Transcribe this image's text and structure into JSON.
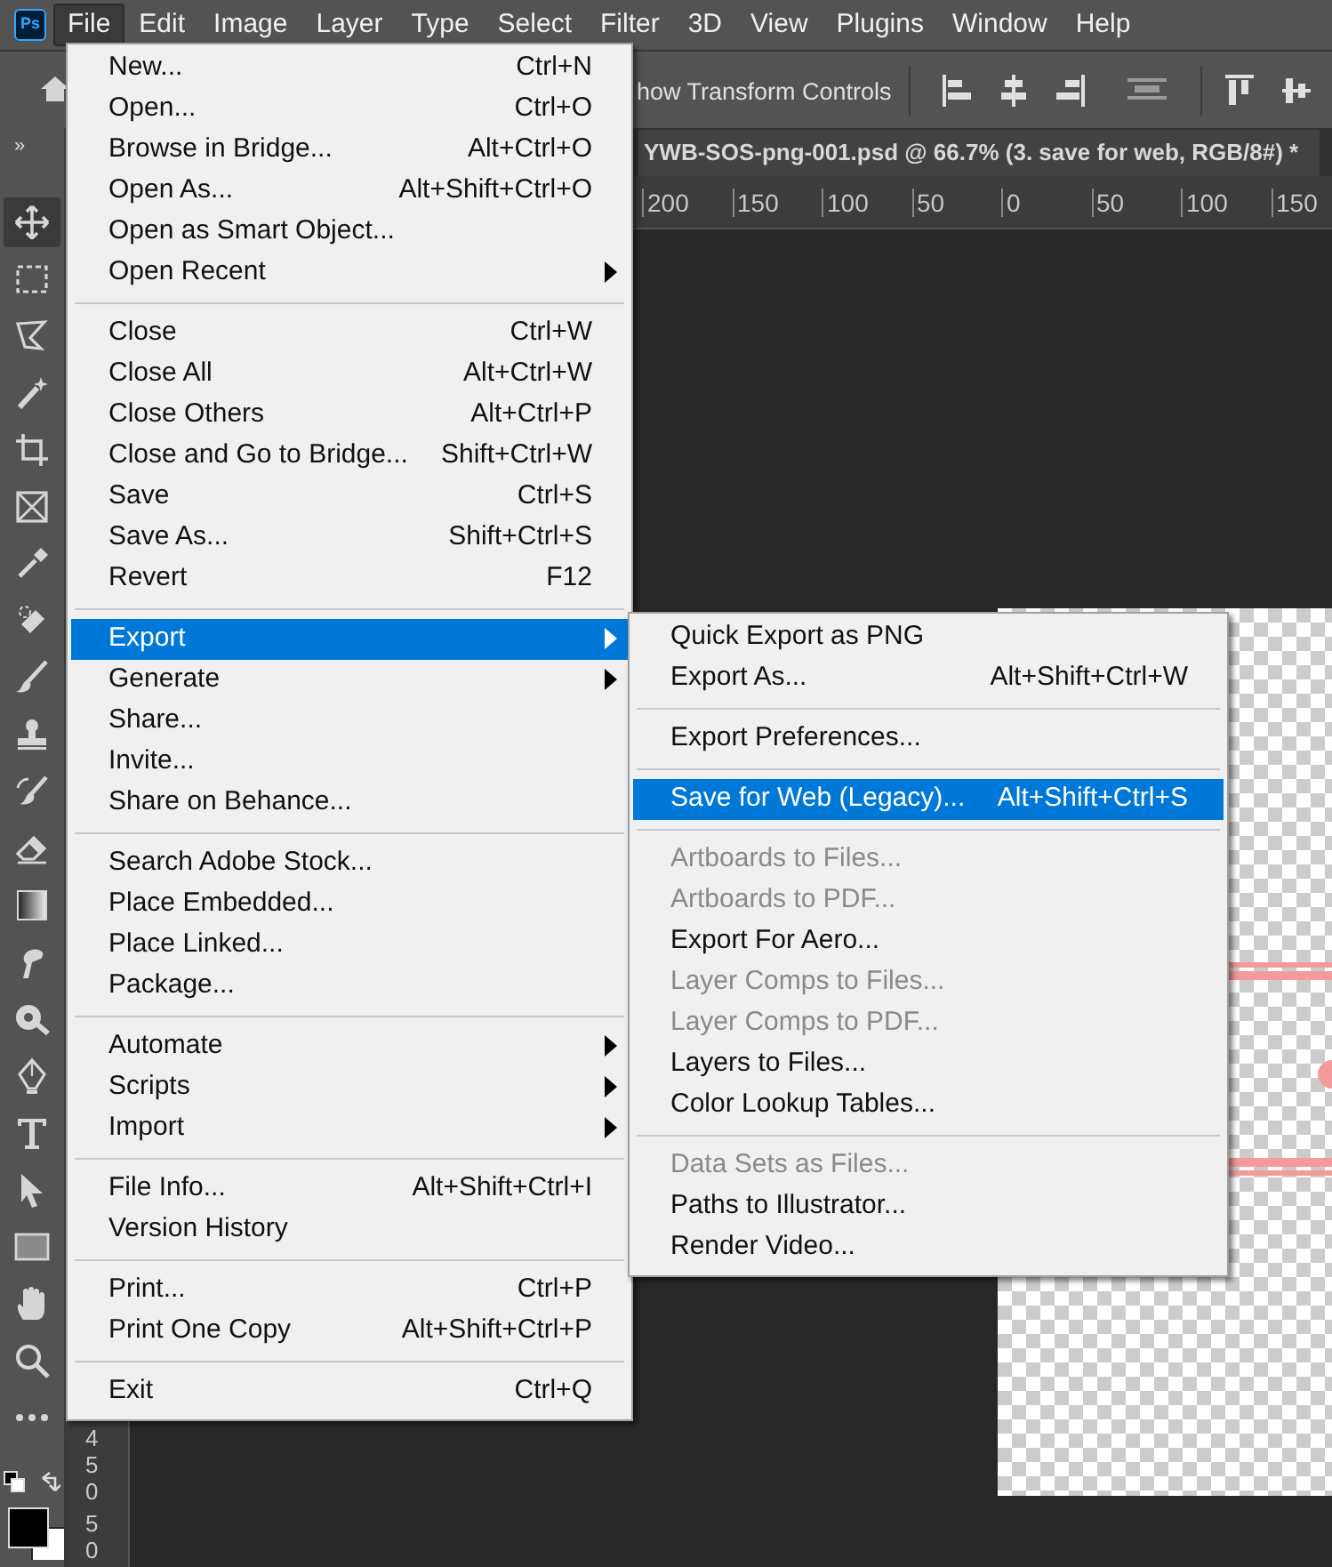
{
  "menubar": [
    {
      "label": "File",
      "selected": true
    },
    {
      "label": "Edit",
      "selected": false
    },
    {
      "label": "Image",
      "selected": false
    },
    {
      "label": "Layer",
      "selected": false
    },
    {
      "label": "Type",
      "selected": false
    },
    {
      "label": "Select",
      "selected": false
    },
    {
      "label": "Filter",
      "selected": false
    },
    {
      "label": "3D",
      "selected": false
    },
    {
      "label": "View",
      "selected": false
    },
    {
      "label": "Plugins",
      "selected": false
    },
    {
      "label": "Window",
      "selected": false
    },
    {
      "label": "Help",
      "selected": false
    }
  ],
  "app_logo": "Ps",
  "options_bar": {
    "transform_label": "how Transform Controls"
  },
  "panel_toggle": "»",
  "document_tab": {
    "title": "YWB-SOS-png-001.psd @ 66.7% (3. save for web, RGB/8#) *"
  },
  "horizontal_ruler": [
    "200",
    "150",
    "100",
    "50",
    "0",
    "50",
    "100",
    "150"
  ],
  "vertical_ruler": [
    "450",
    "50"
  ],
  "tools": [
    {
      "kind": "move",
      "selected": true
    },
    {
      "kind": "marquee",
      "selected": false
    },
    {
      "kind": "lasso",
      "selected": false
    },
    {
      "kind": "wand",
      "selected": false
    },
    {
      "kind": "crop",
      "selected": false
    },
    {
      "kind": "frame",
      "selected": false
    },
    {
      "kind": "eyedropper",
      "selected": false
    },
    {
      "kind": "bandage",
      "selected": false
    },
    {
      "kind": "brush",
      "selected": false
    },
    {
      "kind": "stamp",
      "selected": false
    },
    {
      "kind": "history",
      "selected": false
    },
    {
      "kind": "eraser",
      "selected": false
    },
    {
      "kind": "gradient",
      "selected": false
    },
    {
      "kind": "smudge",
      "selected": false
    },
    {
      "kind": "dodge",
      "selected": false
    },
    {
      "kind": "pen",
      "selected": false
    },
    {
      "kind": "type",
      "selected": false
    },
    {
      "kind": "pointer",
      "selected": false
    },
    {
      "kind": "rectangle",
      "selected": false
    },
    {
      "kind": "hand",
      "selected": false
    },
    {
      "kind": "zoom",
      "selected": false
    },
    {
      "kind": "more",
      "selected": false
    }
  ],
  "file_menu": [
    {
      "kind": "item",
      "label": "New...",
      "shortcut": "Ctrl+N",
      "submenu": false,
      "disabled": false,
      "selected": false
    },
    {
      "kind": "item",
      "label": "Open...",
      "shortcut": "Ctrl+O",
      "submenu": false,
      "disabled": false,
      "selected": false
    },
    {
      "kind": "item",
      "label": "Browse in Bridge...",
      "shortcut": "Alt+Ctrl+O",
      "submenu": false,
      "disabled": false,
      "selected": false
    },
    {
      "kind": "item",
      "label": "Open As...",
      "shortcut": "Alt+Shift+Ctrl+O",
      "submenu": false,
      "disabled": false,
      "selected": false
    },
    {
      "kind": "item",
      "label": "Open as Smart Object...",
      "submenu": false,
      "disabled": false,
      "selected": false
    },
    {
      "kind": "item",
      "label": "Open Recent",
      "submenu": true,
      "disabled": false,
      "selected": false
    },
    {
      "kind": "separator"
    },
    {
      "kind": "item",
      "label": "Close",
      "shortcut": "Ctrl+W",
      "submenu": false,
      "disabled": false,
      "selected": false
    },
    {
      "kind": "item",
      "label": "Close All",
      "shortcut": "Alt+Ctrl+W",
      "submenu": false,
      "disabled": false,
      "selected": false
    },
    {
      "kind": "item",
      "label": "Close Others",
      "shortcut": "Alt+Ctrl+P",
      "submenu": false,
      "disabled": false,
      "selected": false
    },
    {
      "kind": "item",
      "label": "Close and Go to Bridge...",
      "shortcut": "Shift+Ctrl+W",
      "submenu": false,
      "disabled": false,
      "selected": false
    },
    {
      "kind": "item",
      "label": "Save",
      "shortcut": "Ctrl+S",
      "submenu": false,
      "disabled": false,
      "selected": false
    },
    {
      "kind": "item",
      "label": "Save As...",
      "shortcut": "Shift+Ctrl+S",
      "submenu": false,
      "disabled": false,
      "selected": false
    },
    {
      "kind": "item",
      "label": "Revert",
      "shortcut": "F12",
      "submenu": false,
      "disabled": false,
      "selected": false
    },
    {
      "kind": "separator"
    },
    {
      "kind": "item",
      "label": "Export",
      "submenu": true,
      "disabled": false,
      "selected": true
    },
    {
      "kind": "item",
      "label": "Generate",
      "submenu": true,
      "disabled": false,
      "selected": false
    },
    {
      "kind": "item",
      "label": "Share...",
      "submenu": false,
      "disabled": false,
      "selected": false
    },
    {
      "kind": "item",
      "label": "Invite...",
      "submenu": false,
      "disabled": false,
      "selected": false
    },
    {
      "kind": "item",
      "label": "Share on Behance...",
      "submenu": false,
      "disabled": false,
      "selected": false
    },
    {
      "kind": "separator"
    },
    {
      "kind": "item",
      "label": "Search Adobe Stock...",
      "submenu": false,
      "disabled": false,
      "selected": false
    },
    {
      "kind": "item",
      "label": "Place Embedded...",
      "submenu": false,
      "disabled": false,
      "selected": false
    },
    {
      "kind": "item",
      "label": "Place Linked...",
      "submenu": false,
      "disabled": false,
      "selected": false
    },
    {
      "kind": "item",
      "label": "Package...",
      "submenu": false,
      "disabled": false,
      "selected": false
    },
    {
      "kind": "separator"
    },
    {
      "kind": "item",
      "label": "Automate",
      "submenu": true,
      "disabled": false,
      "selected": false
    },
    {
      "kind": "item",
      "label": "Scripts",
      "submenu": true,
      "disabled": false,
      "selected": false
    },
    {
      "kind": "item",
      "label": "Import",
      "submenu": true,
      "disabled": false,
      "selected": false
    },
    {
      "kind": "separator"
    },
    {
      "kind": "item",
      "label": "File Info...",
      "shortcut": "Alt+Shift+Ctrl+I",
      "submenu": false,
      "disabled": false,
      "selected": false
    },
    {
      "kind": "item",
      "label": "Version History",
      "submenu": false,
      "disabled": false,
      "selected": false
    },
    {
      "kind": "separator"
    },
    {
      "kind": "item",
      "label": "Print...",
      "shortcut": "Ctrl+P",
      "submenu": false,
      "disabled": false,
      "selected": false
    },
    {
      "kind": "item",
      "label": "Print One Copy",
      "shortcut": "Alt+Shift+Ctrl+P",
      "submenu": false,
      "disabled": false,
      "selected": false
    },
    {
      "kind": "separator"
    },
    {
      "kind": "item",
      "label": "Exit",
      "shortcut": "Ctrl+Q",
      "submenu": false,
      "disabled": false,
      "selected": false
    }
  ],
  "export_submenu": [
    {
      "kind": "item",
      "label": "Quick Export as PNG",
      "disabled": false,
      "selected": false
    },
    {
      "kind": "item",
      "label": "Export As...",
      "shortcut": "Alt+Shift+Ctrl+W",
      "disabled": false,
      "selected": false
    },
    {
      "kind": "separator"
    },
    {
      "kind": "item",
      "label": "Export Preferences...",
      "disabled": false,
      "selected": false
    },
    {
      "kind": "separator"
    },
    {
      "kind": "item",
      "label": "Save for Web (Legacy)...",
      "shortcut": "Alt+Shift+Ctrl+S",
      "disabled": false,
      "selected": true
    },
    {
      "kind": "separator"
    },
    {
      "kind": "item",
      "label": "Artboards to Files...",
      "disabled": true,
      "selected": false
    },
    {
      "kind": "item",
      "label": "Artboards to PDF...",
      "disabled": true,
      "selected": false
    },
    {
      "kind": "item",
      "label": "Export For Aero...",
      "disabled": false,
      "selected": false
    },
    {
      "kind": "item",
      "label": "Layer Comps to Files...",
      "disabled": true,
      "selected": false
    },
    {
      "kind": "item",
      "label": "Layer Comps to PDF...",
      "disabled": true,
      "selected": false
    },
    {
      "kind": "item",
      "label": "Layers to Files...",
      "disabled": false,
      "selected": false
    },
    {
      "kind": "item",
      "label": "Color Lookup Tables...",
      "disabled": false,
      "selected": false
    },
    {
      "kind": "separator"
    },
    {
      "kind": "item",
      "label": "Data Sets as Files...",
      "disabled": true,
      "selected": false
    },
    {
      "kind": "item",
      "label": "Paths to Illustrator...",
      "disabled": false,
      "selected": false
    },
    {
      "kind": "item",
      "label": "Render Video...",
      "disabled": false,
      "selected": false
    }
  ]
}
